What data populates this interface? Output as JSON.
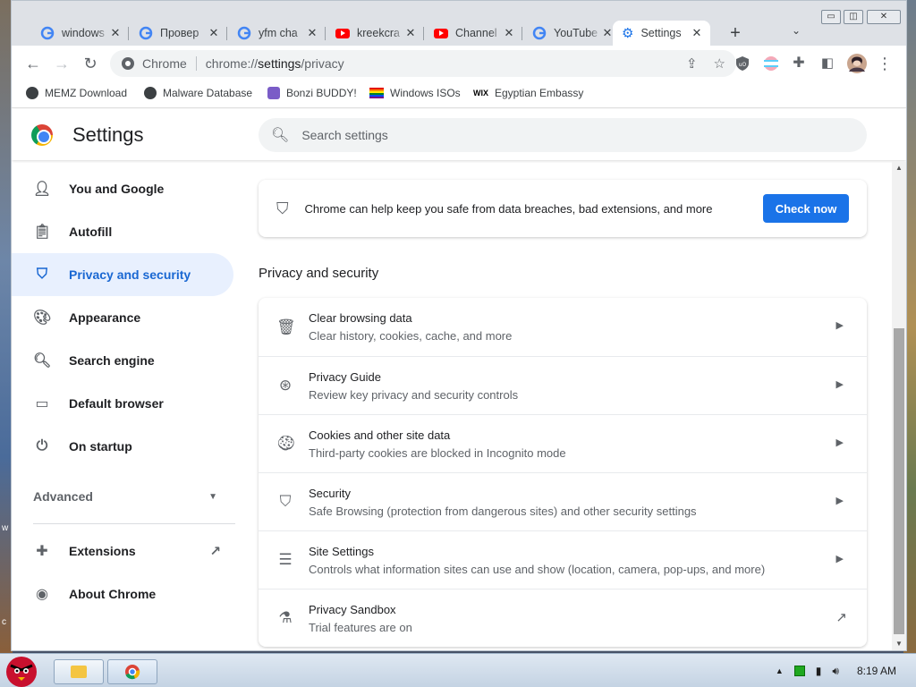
{
  "tabs": [
    {
      "title": "windows",
      "icon": "google-icon",
      "active": false
    },
    {
      "title": "Провер",
      "icon": "google-icon",
      "active": false
    },
    {
      "title": "yfm cha",
      "icon": "google-icon",
      "active": false
    },
    {
      "title": "kreekcra",
      "icon": "youtube-icon",
      "active": false
    },
    {
      "title": "Channel",
      "icon": "youtube-icon",
      "active": false
    },
    {
      "title": "YouTube",
      "icon": "google-icon",
      "active": false
    },
    {
      "title": "Settings",
      "icon": "gear-icon",
      "active": true
    }
  ],
  "omnibox": {
    "chip": "Chrome",
    "url_prefix": "chrome://",
    "url_host": "settings",
    "url_path": "/privacy"
  },
  "bookmarks": [
    {
      "label": "MEMZ Download"
    },
    {
      "label": "Malware Database"
    },
    {
      "label": "Bonzi BUDDY!"
    },
    {
      "label": "Windows ISOs"
    },
    {
      "label": "Egyptian Embassy",
      "prefix": "WIX"
    }
  ],
  "header": {
    "title": "Settings",
    "search_placeholder": "Search settings"
  },
  "sidebar": {
    "items": [
      {
        "label": "You and Google",
        "icon": "person-icon"
      },
      {
        "label": "Autofill",
        "icon": "clipboard-icon"
      },
      {
        "label": "Privacy and security",
        "icon": "shield-icon",
        "active": true
      },
      {
        "label": "Appearance",
        "icon": "palette-icon"
      },
      {
        "label": "Search engine",
        "icon": "search-icon"
      },
      {
        "label": "Default browser",
        "icon": "browser-icon"
      },
      {
        "label": "On startup",
        "icon": "power-icon"
      }
    ],
    "advanced_label": "Advanced",
    "extensions_label": "Extensions",
    "about_label": "About Chrome"
  },
  "safety_check": {
    "text": "Chrome can help keep you safe from data breaches, bad extensions, and more",
    "button_label": "Check now"
  },
  "privacy_section": {
    "title": "Privacy and security",
    "rows": [
      {
        "title": "Clear browsing data",
        "subtitle": "Clear history, cookies, cache, and more",
        "icon": "trash-icon",
        "action": "arrow"
      },
      {
        "title": "Privacy Guide",
        "subtitle": "Review key privacy and security controls",
        "icon": "compass-icon",
        "action": "arrow"
      },
      {
        "title": "Cookies and other site data",
        "subtitle": "Third-party cookies are blocked in Incognito mode",
        "icon": "cookie-icon",
        "action": "arrow"
      },
      {
        "title": "Security",
        "subtitle": "Safe Browsing (protection from dangerous sites) and other security settings",
        "icon": "shield-icon",
        "action": "arrow"
      },
      {
        "title": "Site Settings",
        "subtitle": "Controls what information sites can use and show (location, camera, pop-ups, and more)",
        "icon": "sliders-icon",
        "action": "arrow"
      },
      {
        "title": "Privacy Sandbox",
        "subtitle": "Trial features are on",
        "icon": "flask-icon",
        "action": "external"
      }
    ]
  },
  "taskbar": {
    "clock": "8:19 AM"
  },
  "colors": {
    "accent": "#1a73e8",
    "active_bg": "#e8f0fe",
    "active_text": "#1967d2"
  }
}
